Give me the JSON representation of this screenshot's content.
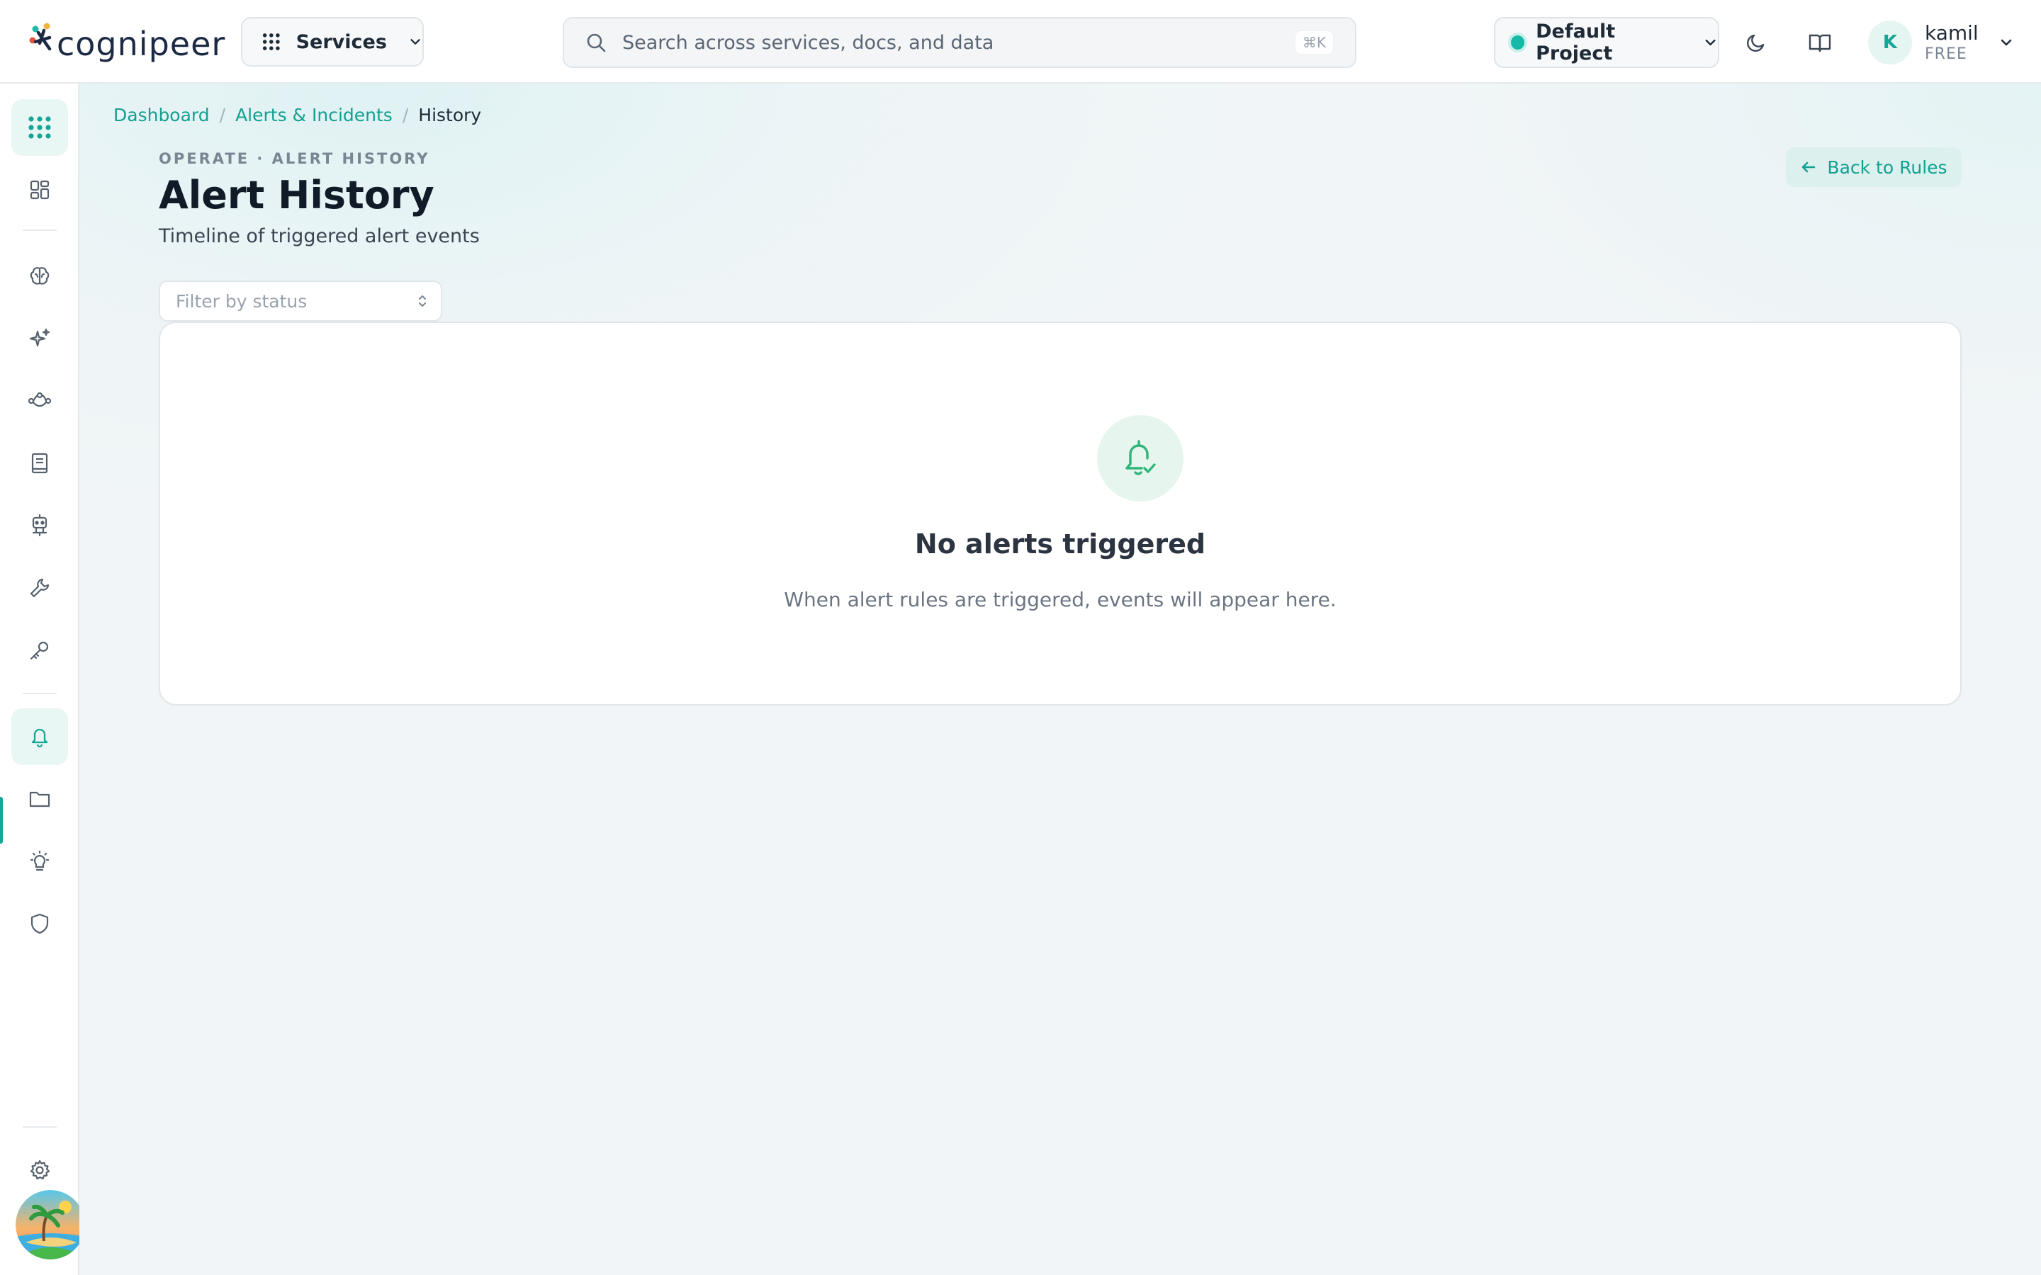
{
  "brand": {
    "name": "cognipeer"
  },
  "topbar": {
    "services_label": "Services",
    "search_placeholder": "Search across services, docs, and data",
    "search_shortcut": "⌘K",
    "project_label": "Default Project",
    "user": {
      "initial": "K",
      "name": "kamil",
      "plan": "FREE"
    }
  },
  "breadcrumb": {
    "items": [
      "Dashboard",
      "Alerts & Incidents"
    ],
    "current": "History"
  },
  "page": {
    "eyebrow": "OPERATE · ALERT HISTORY",
    "title": "Alert History",
    "subtitle": "Timeline of triggered alert events",
    "back_label": "Back to Rules",
    "filter_placeholder": "Filter by status"
  },
  "empty_state": {
    "title": "No alerts triggered",
    "description": "When alert rules are triggered, events will appear here."
  },
  "sidebar": {
    "items": [
      {
        "icon": "apps-grid-icon",
        "active": true
      },
      {
        "icon": "dashboard-icon"
      },
      {
        "icon": "brain-icon"
      },
      {
        "icon": "sparkles-icon"
      },
      {
        "icon": "flow-icon"
      },
      {
        "icon": "book-icon"
      },
      {
        "icon": "robot-icon"
      },
      {
        "icon": "wrench-icon"
      },
      {
        "icon": "key-icon"
      },
      {
        "icon": "bell-icon",
        "active": true
      },
      {
        "icon": "folder-icon"
      },
      {
        "icon": "lightbulb-icon"
      },
      {
        "icon": "shield-icon"
      },
      {
        "icon": "gear-icon"
      }
    ]
  },
  "colors": {
    "accent": "#17a596",
    "accent_bg": "#e8f6f4",
    "success": "#2fb57a"
  }
}
